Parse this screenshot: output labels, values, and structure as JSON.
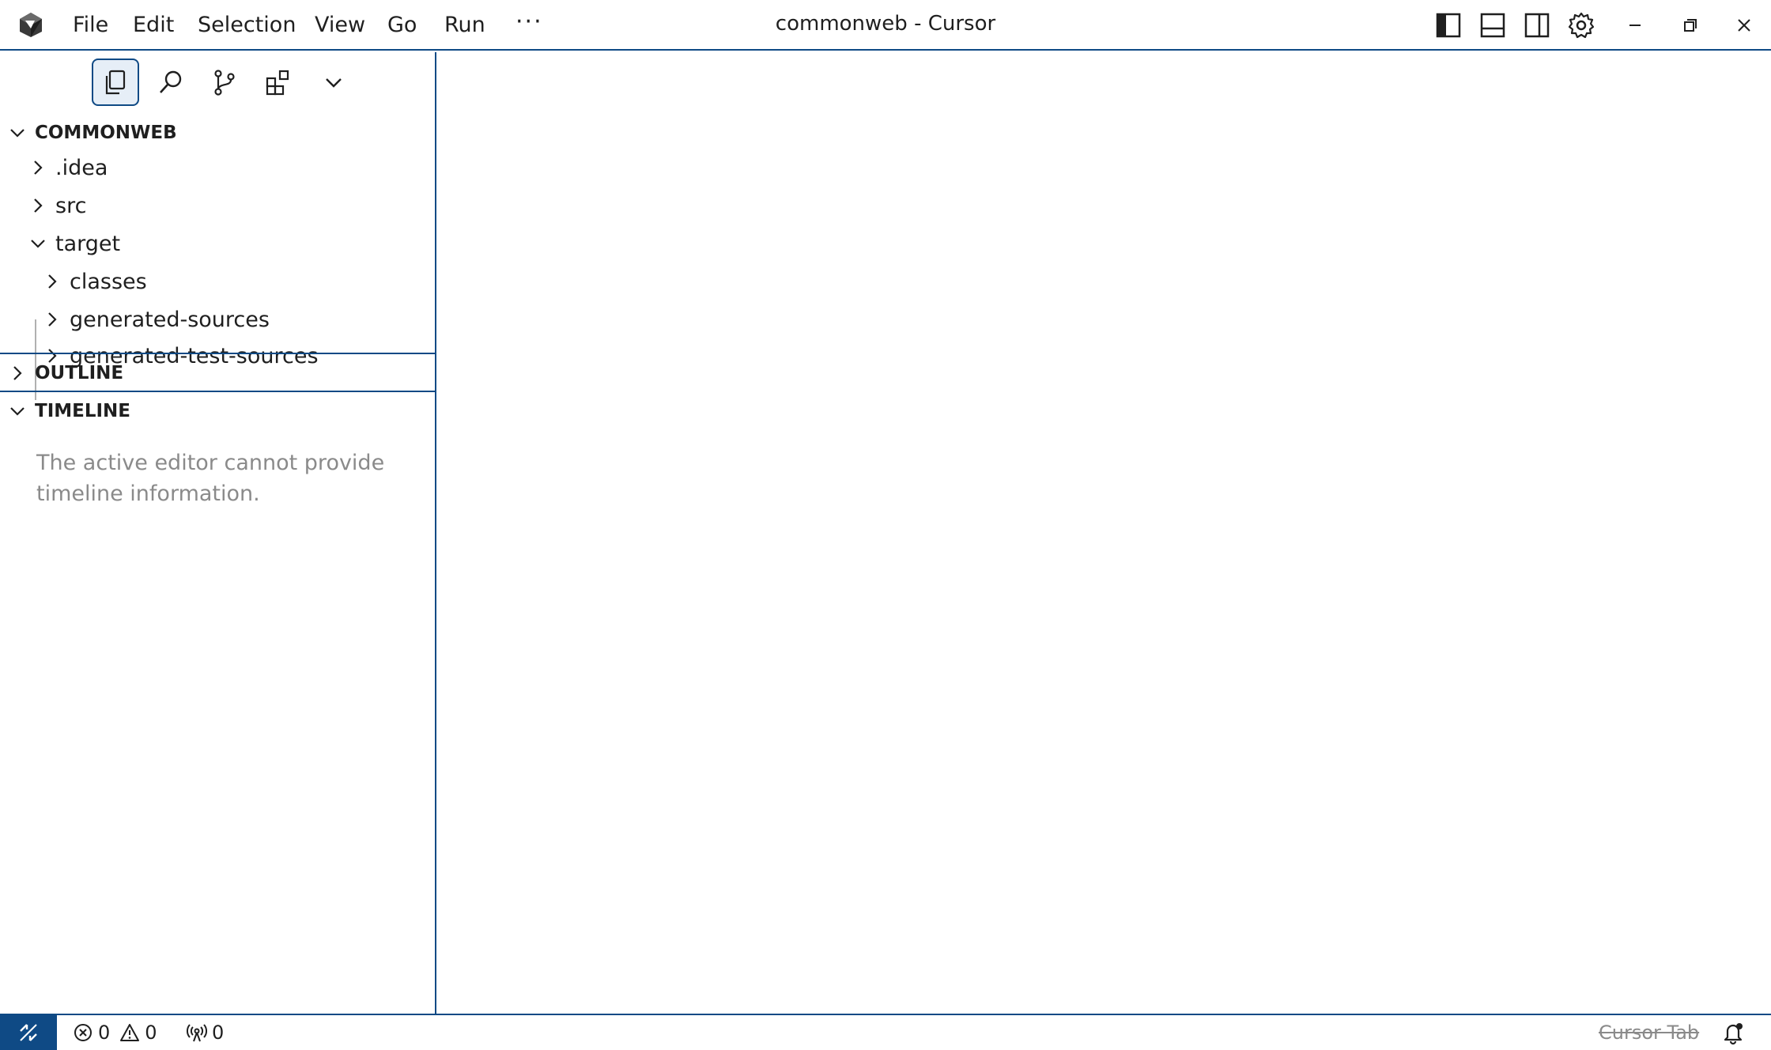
{
  "titlebar": {
    "menu": [
      "File",
      "Edit",
      "Selection",
      "View",
      "Go",
      "Run"
    ],
    "more": "···",
    "title": "commonweb - Cursor"
  },
  "sidebar": {
    "explorer": {
      "root": "COMMONWEB",
      "items": [
        {
          "label": ".idea",
          "expanded": false,
          "depth": 1
        },
        {
          "label": "src",
          "expanded": false,
          "depth": 1
        },
        {
          "label": "target",
          "expanded": true,
          "depth": 1
        },
        {
          "label": "classes",
          "expanded": false,
          "depth": 2
        },
        {
          "label": "generated-sources",
          "expanded": false,
          "depth": 2
        },
        {
          "label": "generated-test-sources",
          "expanded": false,
          "depth": 2
        }
      ]
    },
    "outline": {
      "label": "OUTLINE"
    },
    "timeline": {
      "label": "TIMELINE",
      "message": "The active editor cannot provide timeline information."
    }
  },
  "statusbar": {
    "errors": "0",
    "warnings": "0",
    "ports": "0",
    "cursor_tab": "Cursor Tab"
  },
  "colors": {
    "accent": "#0f4a85",
    "active_bg": "#e6eef7",
    "muted_text": "#8a8a8a"
  }
}
